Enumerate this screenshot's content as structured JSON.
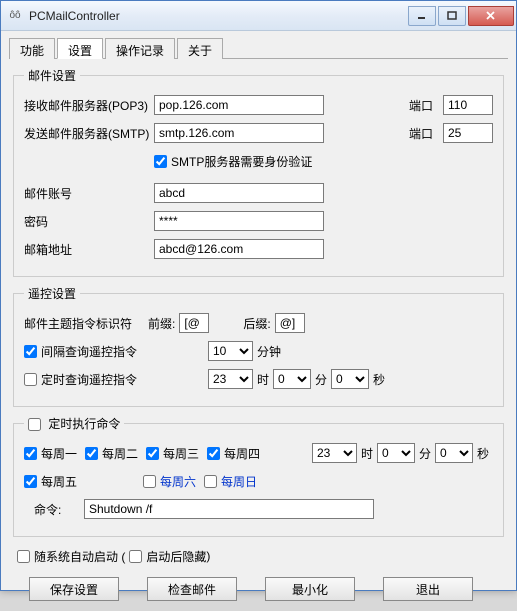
{
  "window": {
    "title": "PCMailController",
    "icon": "ôô"
  },
  "tabs": {
    "items": [
      "功能",
      "设置",
      "操作记录",
      "关于"
    ],
    "active": 1
  },
  "mail": {
    "legend": "邮件设置",
    "pop3_label": "接收邮件服务器(POP3)",
    "pop3_value": "pop.126.com",
    "smtp_label": "发送邮件服务器(SMTP)",
    "smtp_value": "smtp.126.com",
    "port_label": "端口",
    "pop3_port": "110",
    "smtp_port": "25",
    "smtp_auth_label": "SMTP服务器需要身份验证",
    "account_label": "邮件账号",
    "account_value": "abcd",
    "password_label": "密码",
    "password_value": "****",
    "address_label": "邮箱地址",
    "address_value": "abcd@126.com"
  },
  "remote": {
    "legend": "遥控设置",
    "marker_label": "邮件主题指令标识符",
    "prefix_label": "前缀:",
    "prefix_value": "[@",
    "suffix_label": "后缀:",
    "suffix_value": "@]",
    "interval_label": "间隔查询遥控指令",
    "interval_value": "10",
    "interval_unit": "分钟",
    "scheduled_label": "定时查询遥控指令",
    "hour_unit": "时",
    "minute_unit": "分",
    "second_unit": "秒",
    "hour_value": "23",
    "minute_value": "0",
    "second_value": "0"
  },
  "timer": {
    "legend": "定时执行命令",
    "days": [
      "每周一",
      "每周二",
      "每周三",
      "每周四",
      "每周五",
      "每周六",
      "每周日"
    ],
    "hour_value": "23",
    "minute_value": "0",
    "second_value": "0",
    "hour_unit": "时",
    "minute_unit": "分",
    "second_unit": "秒",
    "cmd_label": "命令:",
    "cmd_value": "Shutdown /f"
  },
  "opts": {
    "autostart_label": "随系统自动启动 (",
    "hide_label": "启动后隐藏",
    "close_paren": ")"
  },
  "buttons": {
    "save": "保存设置",
    "check": "检查邮件",
    "minimize": "最小化",
    "exit": "退出"
  }
}
